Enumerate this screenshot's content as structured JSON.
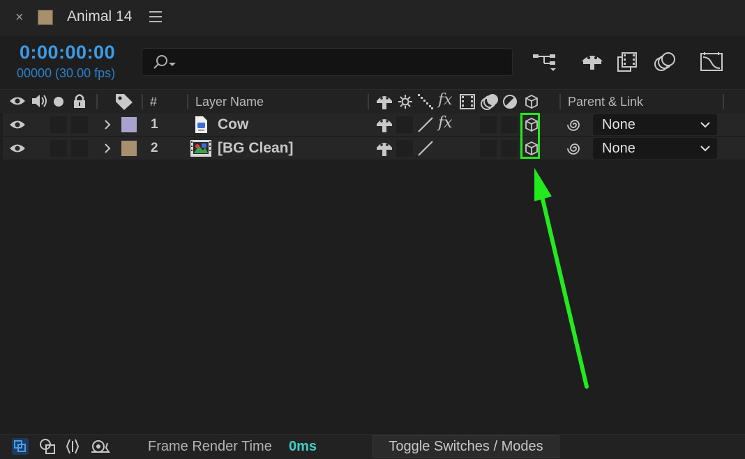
{
  "tab": {
    "close_glyph": "×",
    "title": "Animal 14",
    "swatch_color": "#a88f6d"
  },
  "timecode": {
    "current": "0:00:00:00",
    "frames_fps": "00000 (30.00 fps)"
  },
  "search": {
    "placeholder": ""
  },
  "toolbar_icons": [
    "comp-flowchart-icon",
    "draft-3d-icon",
    "frame-blending-icon",
    "motion-blur-icon",
    "graph-editor-icon"
  ],
  "columns": {
    "av_icons": [
      "eye-icon",
      "audio-icon",
      "solo-dot-icon",
      "lock-icon"
    ],
    "label_icon": "label-tag-icon",
    "number": "#",
    "layer_name": "Layer Name",
    "switch_icons": [
      "shy-icon",
      "collapse-sun-icon",
      "quality-icon",
      "fx-icon",
      "adjustment-icon",
      "motion-blur-icon",
      "adjustment-layer-icon",
      "3d-layer-cube-icon"
    ],
    "fx_label": "fx",
    "parent_link": "Parent & Link"
  },
  "layers": [
    {
      "index": "1",
      "name": "Cow",
      "label_color": "#a7a3cc",
      "type_icon": "file-document-icon",
      "has_fx": true,
      "parent": "None"
    },
    {
      "index": "2",
      "name": "[BG Clean]",
      "label_color": "#a88f6d",
      "type_icon": "video-footage-icon",
      "has_fx": false,
      "parent": "None"
    }
  ],
  "footer": {
    "icons": [
      "comp-mini-icon",
      "shapes-icon",
      "brackets-icon",
      "snail-icon"
    ],
    "frame_render_label": "Frame Render Time",
    "frame_render_value": "0ms",
    "toggle_button": "Toggle Switches / Modes"
  },
  "annotation": {
    "highlight_color": "#23ea1d"
  }
}
